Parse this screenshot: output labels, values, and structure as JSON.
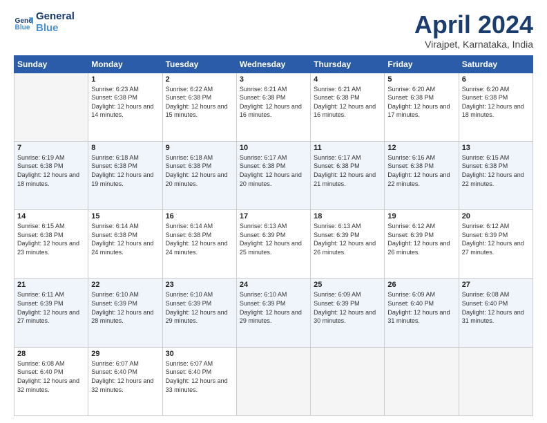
{
  "header": {
    "logo_general": "General",
    "logo_blue": "Blue",
    "month_title": "April 2024",
    "location": "Virajpet, Karnataka, India"
  },
  "days_of_week": [
    "Sunday",
    "Monday",
    "Tuesday",
    "Wednesday",
    "Thursday",
    "Friday",
    "Saturday"
  ],
  "weeks": [
    [
      {
        "day": "",
        "empty": true
      },
      {
        "day": "1",
        "sunrise": "6:23 AM",
        "sunset": "6:38 PM",
        "daylight": "12 hours and 14 minutes."
      },
      {
        "day": "2",
        "sunrise": "6:22 AM",
        "sunset": "6:38 PM",
        "daylight": "12 hours and 15 minutes."
      },
      {
        "day": "3",
        "sunrise": "6:21 AM",
        "sunset": "6:38 PM",
        "daylight": "12 hours and 16 minutes."
      },
      {
        "day": "4",
        "sunrise": "6:21 AM",
        "sunset": "6:38 PM",
        "daylight": "12 hours and 16 minutes."
      },
      {
        "day": "5",
        "sunrise": "6:20 AM",
        "sunset": "6:38 PM",
        "daylight": "12 hours and 17 minutes."
      },
      {
        "day": "6",
        "sunrise": "6:20 AM",
        "sunset": "6:38 PM",
        "daylight": "12 hours and 18 minutes."
      }
    ],
    [
      {
        "day": "7",
        "sunrise": "6:19 AM",
        "sunset": "6:38 PM",
        "daylight": "12 hours and 18 minutes."
      },
      {
        "day": "8",
        "sunrise": "6:18 AM",
        "sunset": "6:38 PM",
        "daylight": "12 hours and 19 minutes."
      },
      {
        "day": "9",
        "sunrise": "6:18 AM",
        "sunset": "6:38 PM",
        "daylight": "12 hours and 20 minutes."
      },
      {
        "day": "10",
        "sunrise": "6:17 AM",
        "sunset": "6:38 PM",
        "daylight": "12 hours and 20 minutes."
      },
      {
        "day": "11",
        "sunrise": "6:17 AM",
        "sunset": "6:38 PM",
        "daylight": "12 hours and 21 minutes."
      },
      {
        "day": "12",
        "sunrise": "6:16 AM",
        "sunset": "6:38 PM",
        "daylight": "12 hours and 22 minutes."
      },
      {
        "day": "13",
        "sunrise": "6:15 AM",
        "sunset": "6:38 PM",
        "daylight": "12 hours and 22 minutes."
      }
    ],
    [
      {
        "day": "14",
        "sunrise": "6:15 AM",
        "sunset": "6:38 PM",
        "daylight": "12 hours and 23 minutes."
      },
      {
        "day": "15",
        "sunrise": "6:14 AM",
        "sunset": "6:38 PM",
        "daylight": "12 hours and 24 minutes."
      },
      {
        "day": "16",
        "sunrise": "6:14 AM",
        "sunset": "6:38 PM",
        "daylight": "12 hours and 24 minutes."
      },
      {
        "day": "17",
        "sunrise": "6:13 AM",
        "sunset": "6:39 PM",
        "daylight": "12 hours and 25 minutes."
      },
      {
        "day": "18",
        "sunrise": "6:13 AM",
        "sunset": "6:39 PM",
        "daylight": "12 hours and 26 minutes."
      },
      {
        "day": "19",
        "sunrise": "6:12 AM",
        "sunset": "6:39 PM",
        "daylight": "12 hours and 26 minutes."
      },
      {
        "day": "20",
        "sunrise": "6:12 AM",
        "sunset": "6:39 PM",
        "daylight": "12 hours and 27 minutes."
      }
    ],
    [
      {
        "day": "21",
        "sunrise": "6:11 AM",
        "sunset": "6:39 PM",
        "daylight": "12 hours and 27 minutes."
      },
      {
        "day": "22",
        "sunrise": "6:10 AM",
        "sunset": "6:39 PM",
        "daylight": "12 hours and 28 minutes."
      },
      {
        "day": "23",
        "sunrise": "6:10 AM",
        "sunset": "6:39 PM",
        "daylight": "12 hours and 29 minutes."
      },
      {
        "day": "24",
        "sunrise": "6:10 AM",
        "sunset": "6:39 PM",
        "daylight": "12 hours and 29 minutes."
      },
      {
        "day": "25",
        "sunrise": "6:09 AM",
        "sunset": "6:39 PM",
        "daylight": "12 hours and 30 minutes."
      },
      {
        "day": "26",
        "sunrise": "6:09 AM",
        "sunset": "6:40 PM",
        "daylight": "12 hours and 31 minutes."
      },
      {
        "day": "27",
        "sunrise": "6:08 AM",
        "sunset": "6:40 PM",
        "daylight": "12 hours and 31 minutes."
      }
    ],
    [
      {
        "day": "28",
        "sunrise": "6:08 AM",
        "sunset": "6:40 PM",
        "daylight": "12 hours and 32 minutes."
      },
      {
        "day": "29",
        "sunrise": "6:07 AM",
        "sunset": "6:40 PM",
        "daylight": "12 hours and 32 minutes."
      },
      {
        "day": "30",
        "sunrise": "6:07 AM",
        "sunset": "6:40 PM",
        "daylight": "12 hours and 33 minutes."
      },
      {
        "day": "",
        "empty": true
      },
      {
        "day": "",
        "empty": true
      },
      {
        "day": "",
        "empty": true
      },
      {
        "day": "",
        "empty": true
      }
    ]
  ]
}
